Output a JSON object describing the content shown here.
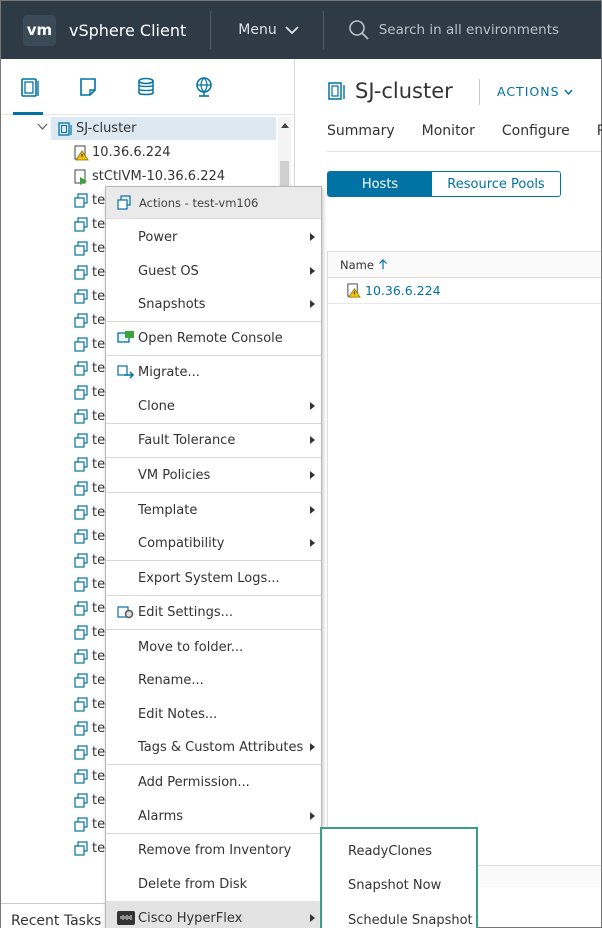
{
  "header": {
    "logo": "vm",
    "app_title": "vSphere Client",
    "menu_label": "Menu",
    "search_placeholder": "Search in all environments"
  },
  "nav": {
    "tabs": [
      "hosts-and-clusters-icon",
      "vms-and-templates-icon",
      "storage-icon",
      "networking-icon"
    ],
    "tree": {
      "cluster": "SJ-cluster",
      "host": "10.36.6.224",
      "controller_vm": "stCtlVM-10.36.6.224",
      "vm_prefix": "te"
    },
    "recent_tasks": "Recent Tasks"
  },
  "main": {
    "title": "SJ-cluster",
    "actions_label": "ACTIONS",
    "tabs": [
      "Summary",
      "Monitor",
      "Configure",
      "P"
    ],
    "segments": [
      "Hosts",
      "Resource Pools"
    ],
    "grid": {
      "column": "Name",
      "rows": [
        "10.36.6.224"
      ]
    }
  },
  "context_menu": {
    "header": "Actions - test-vm106",
    "items": [
      {
        "label": "Power",
        "submenu": true
      },
      {
        "label": "Guest OS",
        "submenu": true
      },
      {
        "label": "Snapshots",
        "submenu": true
      },
      {
        "label": "Open Remote Console",
        "icon": "remote-console-icon"
      },
      {
        "label": "Migrate...",
        "icon": "migrate-icon"
      },
      {
        "label": "Clone",
        "submenu": true
      },
      {
        "label": "Fault Tolerance",
        "submenu": true
      },
      {
        "label": "VM Policies",
        "submenu": true
      },
      {
        "label": "Template",
        "submenu": true
      },
      {
        "label": "Compatibility",
        "submenu": true
      },
      {
        "label": "Export System Logs..."
      },
      {
        "label": "Edit Settings...",
        "icon": "edit-settings-icon"
      },
      {
        "label": "Move to folder..."
      },
      {
        "label": "Rename..."
      },
      {
        "label": "Edit Notes..."
      },
      {
        "label": "Tags & Custom Attributes",
        "submenu": true
      },
      {
        "label": "Add Permission..."
      },
      {
        "label": "Alarms",
        "submenu": true
      },
      {
        "label": "Remove from Inventory"
      },
      {
        "label": "Delete from Disk"
      },
      {
        "label": "Cisco HyperFlex",
        "submenu": true,
        "icon": "cisco-icon"
      }
    ]
  },
  "submenu": {
    "items": [
      "ReadyClones",
      "Snapshot Now",
      "Schedule Snapshot"
    ]
  },
  "colors": {
    "header_bg": "#2e3b47",
    "accent": "#0072a3",
    "submenu_border": "#3a9e83",
    "warning": "#f5c400"
  }
}
